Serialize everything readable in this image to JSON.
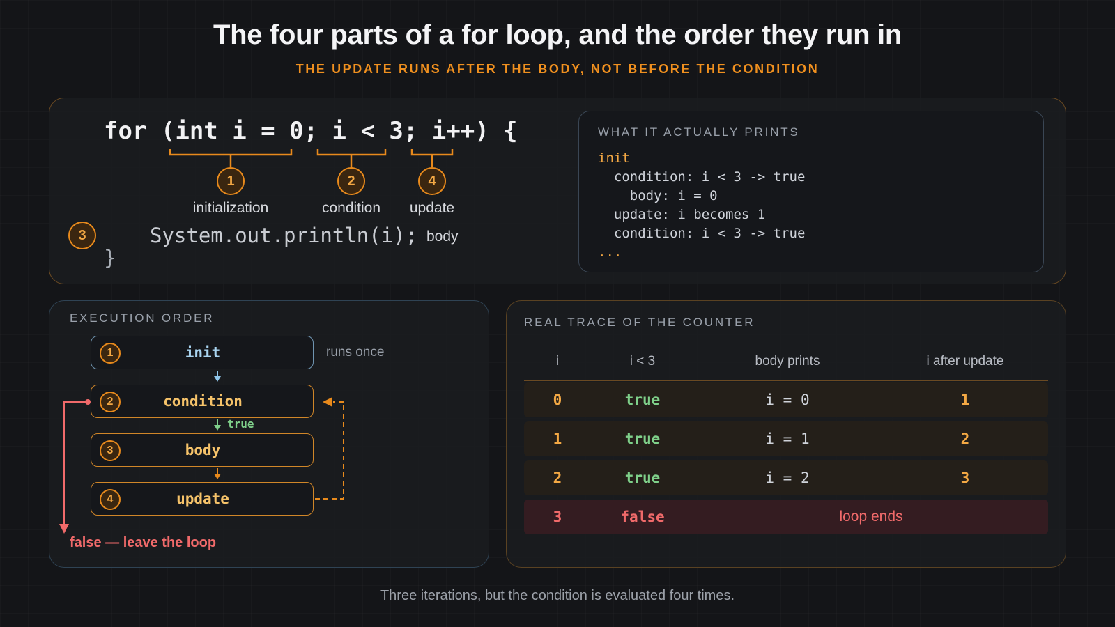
{
  "title": "The four parts of a for loop, and the order they run in",
  "subtitle": "THE UPDATE RUNS AFTER THE BODY, NOT BEFORE THE CONDITION",
  "code": {
    "line1": "for (int i = 0; i < 3; i++) {",
    "body_line": "System.out.println(i);",
    "close_brace": "}",
    "body_label": "body",
    "parts": [
      {
        "num": "1",
        "label": "initialization"
      },
      {
        "num": "2",
        "label": "condition"
      },
      {
        "num": "3",
        "label": "body"
      },
      {
        "num": "4",
        "label": "update"
      }
    ]
  },
  "prints": {
    "heading": "WHAT IT ACTUALLY PRINTS",
    "lines": [
      "init",
      "  condition: i < 3 -> true",
      "    body: i = 0",
      "  update: i becomes 1",
      "  condition: i < 3 -> true",
      "..."
    ]
  },
  "execution": {
    "heading": "EXECUTION ORDER",
    "steps": [
      {
        "num": "1",
        "label": "init"
      },
      {
        "num": "2",
        "label": "condition"
      },
      {
        "num": "3",
        "label": "body"
      },
      {
        "num": "4",
        "label": "update"
      }
    ],
    "runs_once": "runs once",
    "true_label": "true",
    "false_label": "false — leave the loop"
  },
  "trace": {
    "heading": "REAL TRACE OF THE COUNTER",
    "columns": [
      "i",
      "i < 3",
      "body prints",
      "i after update"
    ],
    "rows": [
      {
        "i": "0",
        "cond": "true",
        "prints": "i = 0",
        "after": "1"
      },
      {
        "i": "1",
        "cond": "true",
        "prints": "i = 1",
        "after": "2"
      },
      {
        "i": "2",
        "cond": "true",
        "prints": "i = 2",
        "after": "3"
      }
    ],
    "final_row": {
      "i": "3",
      "cond": "false",
      "note": "loop ends"
    }
  },
  "footer": "Three iterations, but the condition is evaluated four times.",
  "colors": {
    "accent": "#f0901f",
    "true_green": "#7fd08a",
    "false_red": "#f06a6a",
    "init_blue": "#a9d4f0"
  }
}
